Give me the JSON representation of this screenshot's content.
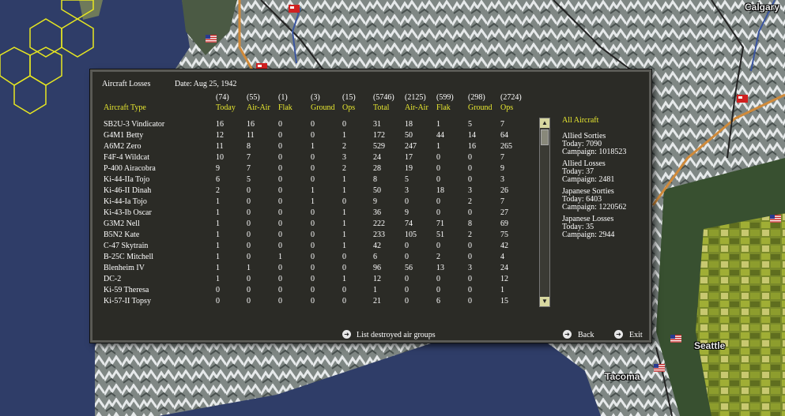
{
  "map": {
    "cities": [
      "Calgary",
      "Seattle",
      "Tacoma"
    ]
  },
  "dialog": {
    "title": "Aircraft Losses",
    "date": "Date:  Aug 25, 1942",
    "totals": [
      "(74)",
      "(55)",
      "(1)",
      "(3)",
      "(15)",
      "(5746)",
      "(2125)",
      "(599)",
      "(298)",
      "(2724)"
    ],
    "headers": [
      "Aircraft Type",
      "Today",
      "Air-Air",
      "Flak",
      "Ground",
      "Ops",
      "Total",
      "Air-Air",
      "Flak",
      "Ground",
      "Ops"
    ],
    "rows": [
      [
        "SB2U-3 Vindicator",
        "16",
        "16",
        "0",
        "0",
        "0",
        "31",
        "18",
        "1",
        "5",
        "7"
      ],
      [
        "G4M1 Betty",
        "12",
        "11",
        "0",
        "0",
        "1",
        "172",
        "50",
        "44",
        "14",
        "64"
      ],
      [
        "A6M2 Zero",
        "11",
        "8",
        "0",
        "1",
        "2",
        "529",
        "247",
        "1",
        "16",
        "265"
      ],
      [
        "F4F-4 Wildcat",
        "10",
        "7",
        "0",
        "0",
        "3",
        "24",
        "17",
        "0",
        "0",
        "7"
      ],
      [
        "P-400 Airacobra",
        "9",
        "7",
        "0",
        "0",
        "2",
        "28",
        "19",
        "0",
        "0",
        "9"
      ],
      [
        "Ki-44-IIa Tojo",
        "6",
        "5",
        "0",
        "0",
        "1",
        "8",
        "5",
        "0",
        "0",
        "3"
      ],
      [
        "Ki-46-II Dinah",
        "2",
        "0",
        "0",
        "1",
        "1",
        "50",
        "3",
        "18",
        "3",
        "26"
      ],
      [
        "Ki-44-Ia Tojo",
        "1",
        "0",
        "0",
        "1",
        "0",
        "9",
        "0",
        "0",
        "2",
        "7"
      ],
      [
        "Ki-43-Ib Oscar",
        "1",
        "0",
        "0",
        "0",
        "1",
        "36",
        "9",
        "0",
        "0",
        "27"
      ],
      [
        "G3M2 Nell",
        "1",
        "0",
        "0",
        "0",
        "1",
        "222",
        "74",
        "71",
        "8",
        "69"
      ],
      [
        "B5N2 Kate",
        "1",
        "0",
        "0",
        "0",
        "1",
        "233",
        "105",
        "51",
        "2",
        "75"
      ],
      [
        "C-47 Skytrain",
        "1",
        "0",
        "0",
        "0",
        "1",
        "42",
        "0",
        "0",
        "0",
        "42"
      ],
      [
        "B-25C Mitchell",
        "1",
        "0",
        "1",
        "0",
        "0",
        "6",
        "0",
        "2",
        "0",
        "4"
      ],
      [
        "Blenheim IV",
        "1",
        "1",
        "0",
        "0",
        "0",
        "96",
        "56",
        "13",
        "3",
        "24"
      ],
      [
        "DC-2",
        "1",
        "0",
        "0",
        "0",
        "1",
        "12",
        "0",
        "0",
        "0",
        "12"
      ],
      [
        "Ki-59 Theresa",
        "0",
        "0",
        "0",
        "0",
        "0",
        "1",
        "0",
        "0",
        "0",
        "1"
      ],
      [
        "Ki-57-II Topsy",
        "0",
        "0",
        "0",
        "0",
        "0",
        "21",
        "0",
        "6",
        "0",
        "15"
      ]
    ],
    "side": {
      "filter": "All Aircraft",
      "allied_sorties_title": "Allied Sorties",
      "allied_sorties_today": "Today:    7090",
      "allied_sorties_campaign": "Campaign: 1018523",
      "allied_losses_title": "Allied Losses",
      "allied_losses_today": "Today:    37",
      "allied_losses_campaign": "Campaign: 2481",
      "japanese_sorties_title": "Japanese Sorties",
      "japanese_sorties_today": "Today:    6403",
      "japanese_sorties_campaign": "Campaign: 1220562",
      "japanese_losses_title": "Japanese Losses",
      "japanese_losses_today": "Today:    35",
      "japanese_losses_campaign": "Campaign: 2944"
    },
    "buttons": {
      "list_destroyed": "List destroyed air groups",
      "back": "Back",
      "exit": "Exit"
    }
  },
  "colors": {
    "dialog_bg": "#2b2b26",
    "header_yellow": "#e8e830",
    "ocean": "#2f3d68",
    "hex_grid": "#e8e820"
  }
}
